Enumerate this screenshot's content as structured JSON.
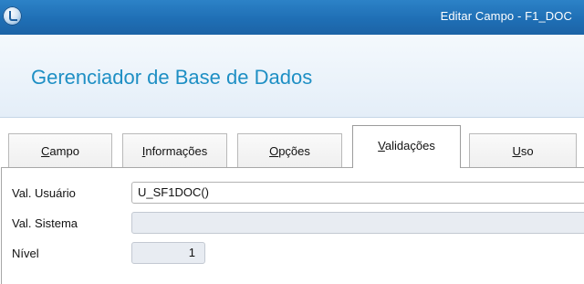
{
  "window": {
    "title": "Editar Campo - F1_DOC"
  },
  "header": {
    "title": "Gerenciador de Base de Dados"
  },
  "tabs": [
    {
      "label": "Campo",
      "mnemonic": "C",
      "rest": "ampo",
      "active": false
    },
    {
      "label": "Informações",
      "mnemonic": "I",
      "rest": "nformações",
      "active": false
    },
    {
      "label": "Opções",
      "mnemonic": "O",
      "rest": "pções",
      "active": false
    },
    {
      "label": "Validações",
      "mnemonic": "V",
      "rest": "alidações",
      "active": true
    },
    {
      "label": "Uso",
      "mnemonic": "U",
      "rest": "so",
      "active": false
    }
  ],
  "fields": {
    "val_usuario": {
      "label": "Val. Usuário",
      "value": "U_SF1DOC()"
    },
    "val_sistema": {
      "label": "Val. Sistema",
      "value": ""
    },
    "nivel": {
      "label": "Nível",
      "value": "1"
    }
  },
  "colors": {
    "titlebar": "#1f6fb5",
    "header_title": "#1e8fc4",
    "readonly_field": "#e8ecf2"
  },
  "icons": {
    "app_icon": "app-logo-icon"
  }
}
